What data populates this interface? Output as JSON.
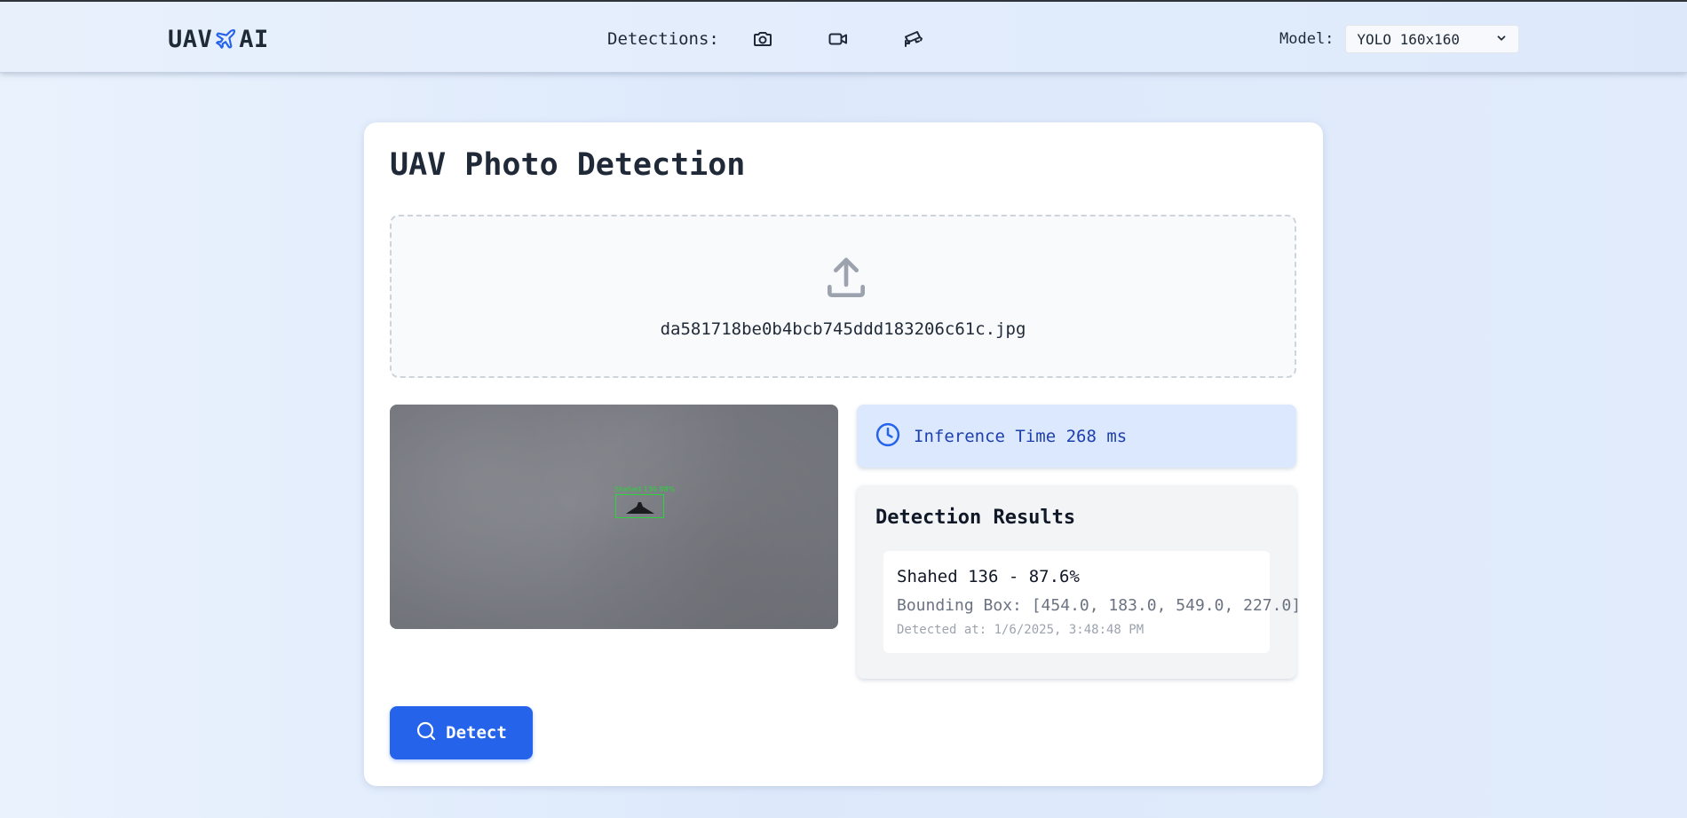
{
  "header": {
    "logo_left": "UAV",
    "logo_right": "AI",
    "detections_label": "Detections:",
    "nav_icons": [
      "camera-icon",
      "video-icon",
      "cctv-camera-icon"
    ],
    "model_label": "Model:",
    "model_selected": "YOLO 160x160"
  },
  "main": {
    "title": "UAV Photo Detection",
    "upload": {
      "icon": "upload-icon",
      "filename": "da581718be0b4bcb745ddd183206c61c.jpg"
    },
    "preview": {
      "bbox_label": "Shahed 136 88%"
    },
    "inference": {
      "icon": "clock-icon",
      "text": "Inference Time 268 ms"
    },
    "results": {
      "title": "Detection Results",
      "items": [
        {
          "name": "Shahed 136 - 87.6%",
          "bbox": "Bounding Box: [454.0, 183.0, 549.0, 227.0]",
          "time": "Detected at: 1/6/2025, 3:48:48 PM"
        }
      ]
    },
    "detect_button": "Detect"
  },
  "colors": {
    "accent": "#2563eb",
    "inference_text": "#1e40af",
    "bbox": "#2bd43b"
  }
}
